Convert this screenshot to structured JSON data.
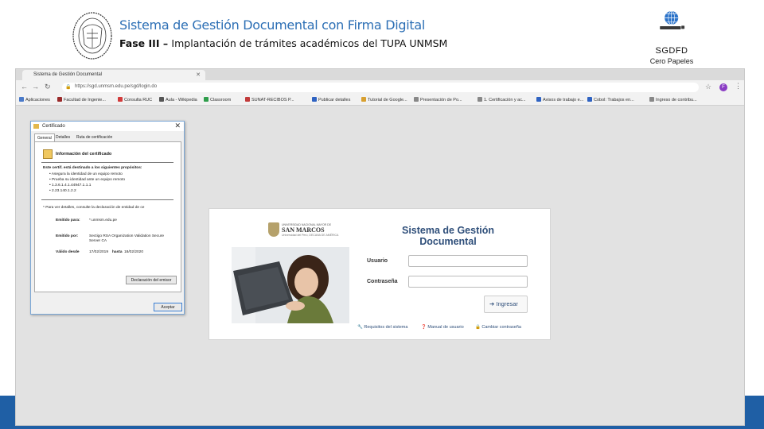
{
  "slide": {
    "title": "Sistema de Gestión Documental con Firma Digital",
    "subtitle_bold": "Fase III – ",
    "subtitle": "Implantación de trámites académicos del TUPA UNMSM",
    "logo_name": "SGDFD",
    "logo_tagline": "Cero Papeles"
  },
  "browser": {
    "tab_title": "Sistema de Gestión Documental",
    "url": "https://sgd.unmsm.edu.pe/sgd/login.do",
    "profile_initial": "F",
    "bookmarks": [
      {
        "label": "Aplicaciones",
        "color": "#4a7ac9"
      },
      {
        "label": "Facultad de Ingenie...",
        "color": "#9a2a2a"
      },
      {
        "label": "Consulta RUC",
        "color": "#d23b3b"
      },
      {
        "label": "Aula - Wikipedia",
        "color": "#555555"
      },
      {
        "label": "Classroom",
        "color": "#2f9e4b"
      },
      {
        "label": "SUNAT-RECIBOS P...",
        "color": "#c23b3b"
      },
      {
        "label": "Publicar detalles",
        "color": "#2f63c2"
      },
      {
        "label": "Tutorial de Google...",
        "color": "#d8a030"
      },
      {
        "label": "Presentación de Po...",
        "color": "#888888"
      },
      {
        "label": "1. Certificación y ac...",
        "color": "#888888"
      },
      {
        "label": "Avisos de trabajo e...",
        "color": "#2f63c2"
      },
      {
        "label": "Cobol: Trabajos en...",
        "color": "#2f63c2"
      },
      {
        "label": "Ingreso de contribu...",
        "color": "#888888"
      }
    ]
  },
  "certificate": {
    "title": "Certificado",
    "tabs": [
      "General",
      "Detalles",
      "Ruta de certificación"
    ],
    "info_title": "Información del certificado",
    "purpose_heading": "Este certif. está destinado a los siguientes propósitos:",
    "purposes": [
      "• Asegura la identidad de un equipo remoto",
      "• Prueba su identidad ante un equipo remoto",
      "• 1.3.6.1.4.1.44947.1.1.1",
      "• 2.23.140.1.2.2"
    ],
    "note": "* Para ver detalles, consulte la declaración de entidad de ce",
    "issued_to_label": "Emitido para:",
    "issued_to_value": "*.unmsm.edu.pe",
    "issued_by_label": "Emitido por:",
    "issued_by_value": "Sectigo RSA Organization Validation Secure Server CA",
    "valid_label": "Válido desde",
    "valid_from": "17/02/2019",
    "valid_to_label": "hasta",
    "valid_to": "18/02/2020",
    "declaration_button": "Declaración del emisor",
    "accept_button": "Aceptar"
  },
  "login": {
    "univ_top": "UNIVERSIDAD NACIONAL MAYOR DE",
    "univ_name": "SAN MARCOS",
    "univ_bottom": "Universidad del Perú, DECANA DE AMÉRICA",
    "title_line1": "Sistema de Gestión",
    "title_line2": "Documental",
    "user_label": "Usuario",
    "password_label": "Contraseña",
    "user_value": "",
    "password_value": "",
    "submit_label": "Ingresar",
    "links": [
      "Requisitos del sistema",
      "Manual de usuario",
      "Cambiar contraseña"
    ]
  },
  "colors": {
    "title_blue": "#2c6fb5",
    "bottom_bar": "#1f5fa5",
    "login_title": "#2f4f7a"
  }
}
